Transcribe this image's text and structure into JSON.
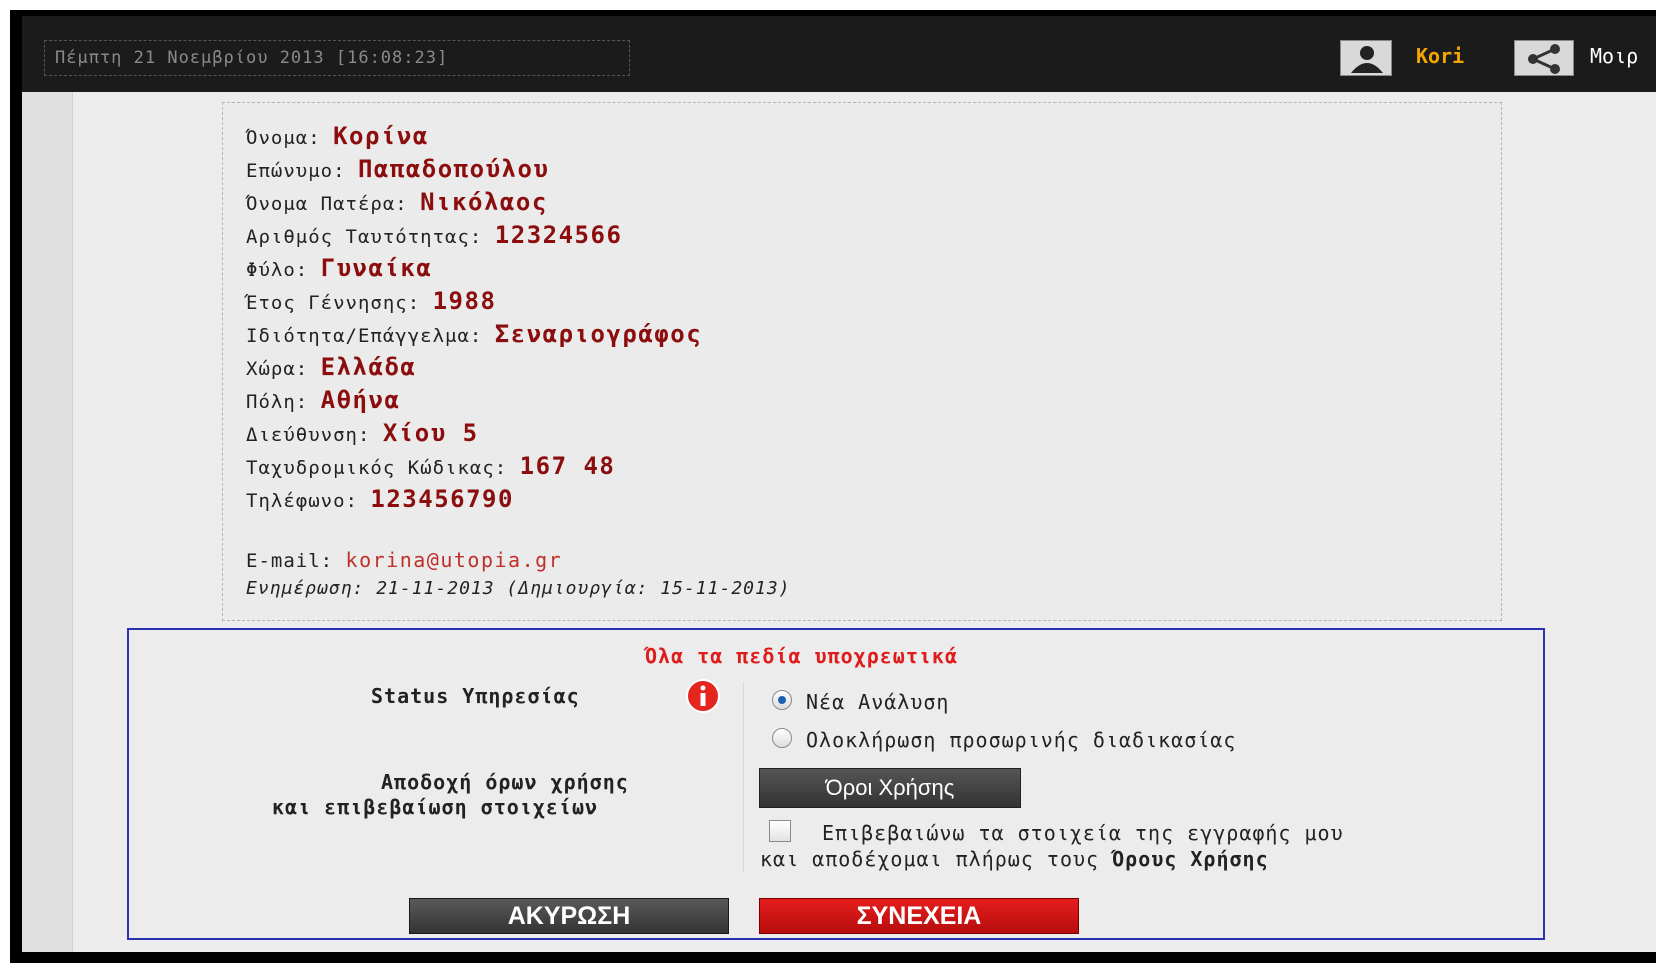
{
  "header": {
    "datetime": "Πέμπτη 21 Νοεμβρίου 2013 [16:08:23]",
    "username": "Kori",
    "share_label": "Μοιρ"
  },
  "profile": {
    "fields": [
      {
        "label": "Όνομα:",
        "value": "Κορίνα"
      },
      {
        "label": "Επώνυμο:",
        "value": "Παπαδοπούλου"
      },
      {
        "label": "Όνομα Πατέρα:",
        "value": "Νικόλαος"
      },
      {
        "label": "Αριθμός Ταυτότητας:",
        "value": "12324566"
      },
      {
        "label": "Φύλο:",
        "value": "Γυναίκα"
      },
      {
        "label": "Έτος Γέννησης:",
        "value": "1988"
      },
      {
        "label": "Ιδιότητα/Επάγγελμα:",
        "value": "Σεναριογράφος"
      },
      {
        "label": "Χώρα:",
        "value": "Ελλάδα"
      },
      {
        "label": "Πόλη:",
        "value": "Αθήνα"
      },
      {
        "label": "Διεύθυνση:",
        "value": "Χίου 5"
      },
      {
        "label": "Ταχυδρομικός Κώδικας:",
        "value": "167 48"
      },
      {
        "label": "Τηλέφωνο:",
        "value": "123456790"
      }
    ],
    "email_label": "E-mail:",
    "email": "korina@utopia.gr",
    "updated": "Ενημέρωση: 21-11-2013 (Δημιουργία: 15-11-2013)"
  },
  "form": {
    "required_note": "Όλα τα πεδία υποχρεωτικά",
    "status_label": "Status Υπηρεσίας",
    "status_options": [
      "Νέα Ανάλυση",
      "Ολοκλήρωση προσωρινής διαδικασίας"
    ],
    "status_selected": 0,
    "terms_label_line1": "Αποδοχή όρων χρήσης",
    "terms_label_line2": "και επιβεβαίωση στοιχείων",
    "terms_button": "Όροι Χρήσης",
    "confirm_line1": "Επιβεβαιώνω τα στοιχεία της εγγραφής μου",
    "confirm_line2_prefix": "και αποδέχομαι πλήρως τους",
    "confirm_line2_bold": "Όρους Χρήσης",
    "cancel_button": "ΑΚΥΡΩΣΗ",
    "continue_button": "ΣΥΝΕΧΕΙΑ"
  }
}
